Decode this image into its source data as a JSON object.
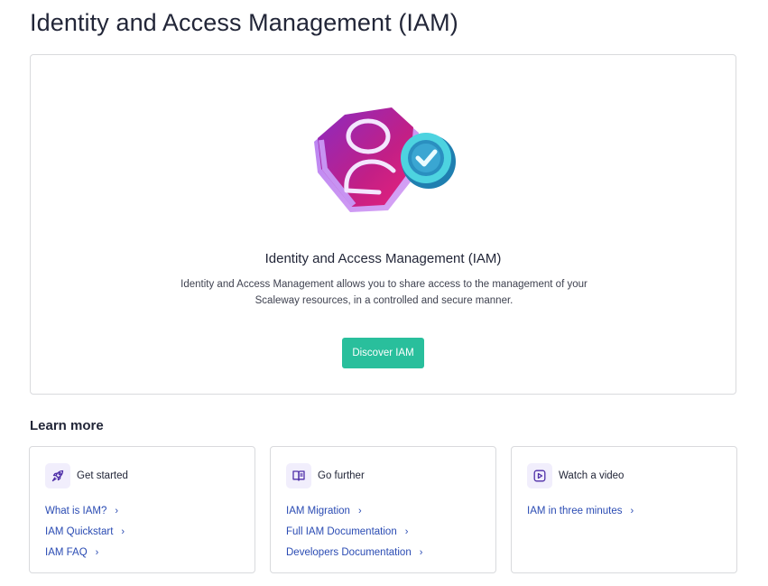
{
  "page": {
    "title": "Identity and Access Management (IAM)"
  },
  "hero": {
    "title": "Identity and Access Management (IAM)",
    "description": "Identity and Access Management allows you to share access to the management of your Scaleway resources, in a controlled and secure manner.",
    "button_label": "Discover IAM",
    "illustration": "shield-user-check-illustration"
  },
  "learn_more": {
    "heading": "Learn more",
    "cards": [
      {
        "icon": "rocket-icon",
        "title": "Get started",
        "links": [
          "What is IAM?",
          "IAM Quickstart",
          "IAM FAQ"
        ]
      },
      {
        "icon": "book-icon",
        "title": "Go further",
        "links": [
          "IAM Migration",
          "Full IAM Documentation",
          "Developers Documentation"
        ]
      },
      {
        "icon": "play-icon",
        "title": "Watch a video",
        "links": [
          "IAM in three minutes"
        ]
      }
    ]
  },
  "colors": {
    "accent": "#29bf9c",
    "link": "#2a4bb3",
    "icon_bg": "#f1eefc",
    "icon_stroke": "#4f2fa8"
  }
}
